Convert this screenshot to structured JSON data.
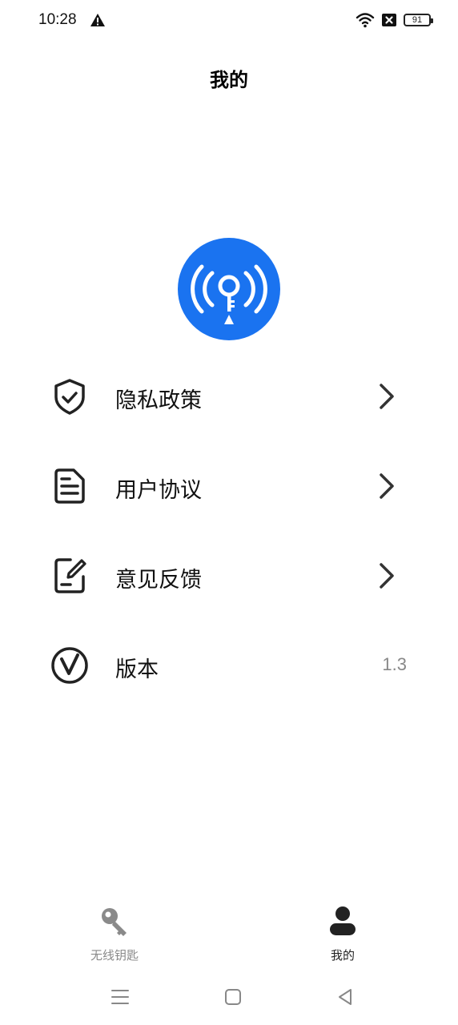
{
  "status_bar": {
    "time": "10:28",
    "battery_level": "91",
    "icons": [
      "alert-icon",
      "wifi-icon",
      "sim-disabled-icon",
      "battery-icon"
    ]
  },
  "header": {
    "title": "我的"
  },
  "logo": {
    "icon": "wifi-key-logo",
    "color": "#1a73f0"
  },
  "menu": {
    "items": [
      {
        "icon": "shield-check-icon",
        "label": "隐私政策",
        "chevron": true
      },
      {
        "icon": "document-icon",
        "label": "用户协议",
        "chevron": true
      },
      {
        "icon": "feedback-edit-icon",
        "label": "意见反馈",
        "chevron": true
      },
      {
        "icon": "version-v-icon",
        "label": "版本",
        "value": "1.3"
      }
    ]
  },
  "bottom_nav": {
    "tabs": [
      {
        "icon": "key-icon",
        "label": "无线钥匙",
        "active": false,
        "color": "#8a8a8a"
      },
      {
        "icon": "user-icon",
        "label": "我的",
        "active": true,
        "color": "#222222"
      }
    ]
  },
  "system_nav": {
    "buttons": [
      "menu-icon",
      "home-icon",
      "back-icon"
    ]
  }
}
